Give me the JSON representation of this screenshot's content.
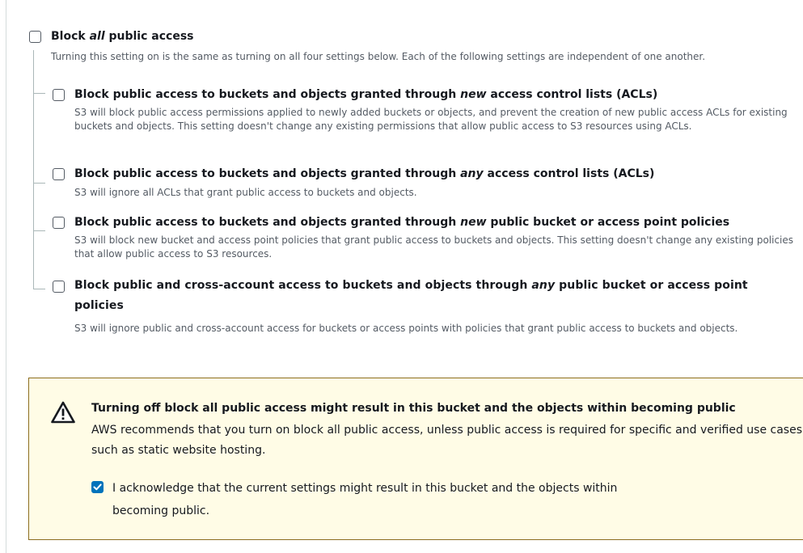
{
  "block_all": {
    "title_before": "Block ",
    "title_em": "all",
    "title_after": " public access",
    "description": "Turning this setting on is the same as turning on all four settings below. Each of the following settings are independent of one another.",
    "checked": false
  },
  "settings": [
    {
      "title_before": "Block public access to buckets and objects granted through ",
      "title_em": "new",
      "title_after": " access control lists (ACLs)",
      "description": "S3 will block public access permissions applied to newly added buckets or objects, and prevent the creation of new public access ACLs for existing buckets and objects. This setting doesn't change any existing permissions that allow public access to S3 resources using ACLs.",
      "checked": false
    },
    {
      "title_before": "Block public access to buckets and objects granted through ",
      "title_em": "any",
      "title_after": " access control lists (ACLs)",
      "description": "S3 will ignore all ACLs that grant public access to buckets and objects.",
      "checked": false
    },
    {
      "title_before": "Block public access to buckets and objects granted through ",
      "title_em": "new",
      "title_after": " public bucket or access point policies",
      "description": "S3 will block new bucket and access point policies that grant public access to buckets and objects. This setting doesn't change any existing policies that allow public access to S3 resources.",
      "checked": false
    },
    {
      "title_before": "Block public and cross-account access to buckets and objects through ",
      "title_em": "any",
      "title_after": " public bucket or access point policies",
      "description": "S3 will ignore public and cross-account access for buckets or access points with policies that grant public access to buckets and objects.",
      "checked": false
    }
  ],
  "warning": {
    "icon": "warning-icon",
    "title": "Turning off block all public access might result in this bucket and the objects within becoming public",
    "body": "AWS recommends that you turn on block all public access, unless public access is required for specific and verified use cases such as static website hosting.",
    "acknowledge_label": "I acknowledge that the current settings might result in this bucket and the objects within becoming public.",
    "acknowledge_checked": true
  },
  "colors": {
    "checkbox_checked": "#0073bb",
    "warning_background": "#fffce6",
    "warning_border": "#8c6d1f",
    "description_text": "#545b64"
  }
}
